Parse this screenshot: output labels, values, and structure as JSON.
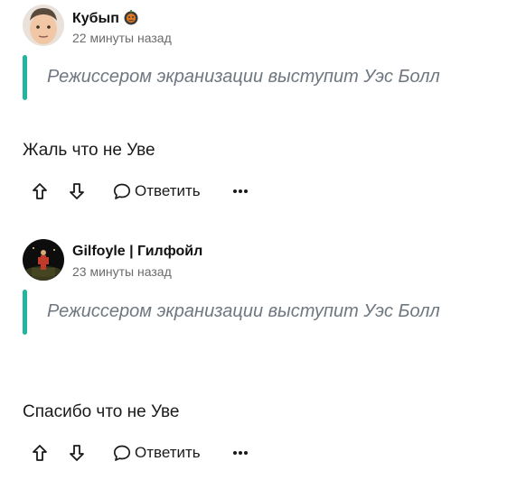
{
  "colors": {
    "accent": "#21b5a0",
    "text": "#1a1a1a",
    "muted": "#6b6b6b",
    "quote_text": "#6f7780"
  },
  "comments": [
    {
      "author": "Кубып",
      "badge_icon": "pumpkin-badge-icon",
      "avatar_icon": "avatar-cartoon-face",
      "time": "22 минуты назад",
      "quote": "Режиссером экранизации выступит Уэс Болл",
      "text": "Жаль что не Уве",
      "actions": {
        "upvote_icon": "arrow-up-icon",
        "downvote_icon": "arrow-down-icon",
        "reply_icon": "speech-bubble-icon",
        "reply_label": "Ответить",
        "more_icon": "more-dots-icon"
      }
    },
    {
      "author": "Gilfoyle | Гилфойл",
      "avatar_icon": "avatar-photo-dark",
      "time": "23 минуты назад",
      "quote": "Режиссером экранизации выступит Уэс Болл",
      "text": "Спасибо что не Уве",
      "actions": {
        "upvote_icon": "arrow-up-icon",
        "downvote_icon": "arrow-down-icon",
        "reply_icon": "speech-bubble-icon",
        "reply_label": "Ответить",
        "more_icon": "more-dots-icon"
      }
    }
  ]
}
